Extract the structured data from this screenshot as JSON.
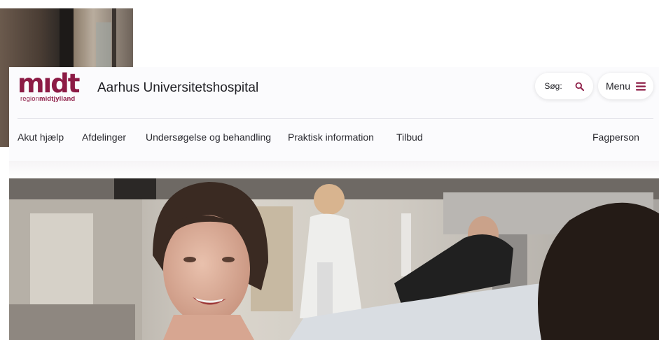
{
  "brand": {
    "logo_word": "mıdt",
    "logo_sub_prefix": "region",
    "logo_sub_bold": "midtjylland",
    "site_title": "Aarhus Universitetshospital",
    "color": "#8c1b45"
  },
  "header": {
    "search_label": "Søg:",
    "search_icon": "search-icon",
    "menu_label": "Menu",
    "menu_icon": "hamburger-icon"
  },
  "nav": {
    "items": [
      {
        "label": "Akut hjælp"
      },
      {
        "label": "Afdelinger"
      },
      {
        "label": "Undersøgelse og behandling"
      },
      {
        "label": "Praktisk information"
      },
      {
        "label": "Tilbud"
      }
    ],
    "right_item": "Fagperson"
  }
}
